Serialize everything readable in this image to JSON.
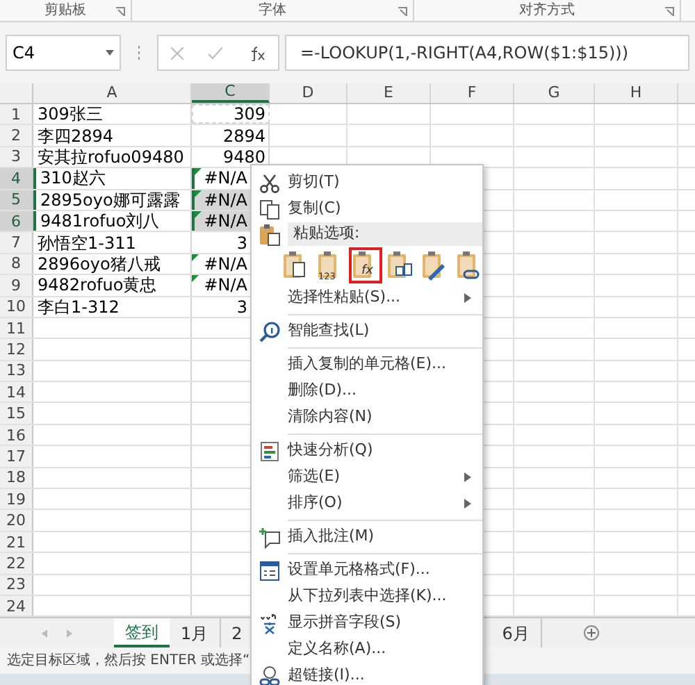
{
  "ribbon_groups": [
    {
      "label": "剪贴板"
    },
    {
      "label": "字体"
    },
    {
      "label": "对齐方式"
    }
  ],
  "formula_bar": {
    "name_box": "C4",
    "formula": "=-LOOKUP(1,-RIGHT(A4,ROW($1:$15)))"
  },
  "columns": [
    {
      "label": "A",
      "selected": false
    },
    {
      "label": "C",
      "selected": true
    },
    {
      "label": "D",
      "selected": false
    },
    {
      "label": "E",
      "selected": false
    },
    {
      "label": "F",
      "selected": false
    },
    {
      "label": "G",
      "selected": false
    },
    {
      "label": "H",
      "selected": false
    }
  ],
  "rows": [
    {
      "label": "1",
      "a": "309张三",
      "c": "309",
      "selected": false,
      "active": false,
      "flag": false,
      "copied": true
    },
    {
      "label": "2",
      "a": "李四2894",
      "c": "2894",
      "selected": false,
      "active": false,
      "flag": false,
      "copied": false
    },
    {
      "label": "3",
      "a": "安其拉rofuo09480",
      "c": "9480",
      "selected": false,
      "active": false,
      "flag": false,
      "copied": false
    },
    {
      "label": "4",
      "a": "310赵六",
      "c": "#N/A",
      "selected": true,
      "active": true,
      "flag": true,
      "copied": false
    },
    {
      "label": "5",
      "a": "2895oyo娜可露露",
      "c": "#N/A",
      "selected": true,
      "active": false,
      "flag": true,
      "copied": false
    },
    {
      "label": "6",
      "a": "9481rofuo刘八",
      "c": "#N/A",
      "selected": true,
      "active": false,
      "flag": true,
      "copied": false
    },
    {
      "label": "7",
      "a": "孙悟空1-311",
      "c": "3",
      "selected": false,
      "active": false,
      "flag": false,
      "copied": false
    },
    {
      "label": "8",
      "a": "2896oyo猪八戒",
      "c": "#N/A",
      "selected": false,
      "active": false,
      "flag": true,
      "copied": false
    },
    {
      "label": "9",
      "a": "9482rofuo黄忠",
      "c": "#N/A",
      "selected": false,
      "active": false,
      "flag": true,
      "copied": false
    },
    {
      "label": "10",
      "a": "李白1-312",
      "c": "3",
      "selected": false,
      "active": false,
      "flag": false,
      "copied": false
    },
    {
      "label": "11",
      "selected": false,
      "active": false,
      "flag": false,
      "copied": false
    },
    {
      "label": "12",
      "selected": false,
      "active": false,
      "flag": false,
      "copied": false
    },
    {
      "label": "13",
      "selected": false,
      "active": false,
      "flag": false,
      "copied": false
    },
    {
      "label": "14",
      "selected": false,
      "active": false,
      "flag": false,
      "copied": false
    },
    {
      "label": "15",
      "selected": false,
      "active": false,
      "flag": false,
      "copied": false
    },
    {
      "label": "16",
      "selected": false,
      "active": false,
      "flag": false,
      "copied": false
    },
    {
      "label": "17",
      "selected": false,
      "active": false,
      "flag": false,
      "copied": false
    },
    {
      "label": "18",
      "selected": false,
      "active": false,
      "flag": false,
      "copied": false
    },
    {
      "label": "19",
      "selected": false,
      "active": false,
      "flag": false,
      "copied": false
    },
    {
      "label": "20",
      "selected": false,
      "active": false,
      "flag": false,
      "copied": false
    },
    {
      "label": "21",
      "selected": false,
      "active": false,
      "flag": false,
      "copied": false
    },
    {
      "label": "22",
      "selected": false,
      "active": false,
      "flag": false,
      "copied": false
    },
    {
      "label": "23",
      "selected": false,
      "active": false,
      "flag": false,
      "copied": false
    },
    {
      "label": "24",
      "selected": false,
      "active": false,
      "flag": false,
      "copied": false
    }
  ],
  "sheet_tabs": [
    {
      "label": "签到",
      "selected": true
    },
    {
      "label": "1月",
      "selected": false
    },
    {
      "label": "2",
      "selected": false
    },
    {
      "label": "6月",
      "selected": false
    }
  ],
  "status_bar": "选定目标区域，然后按 ENTER 或选择“",
  "context_menu": [
    {
      "kind": "item",
      "label": "剪切(T)",
      "submenu": false
    },
    {
      "kind": "item",
      "label": "复制(C)",
      "submenu": false
    },
    {
      "kind": "header",
      "label": "粘贴选项:"
    },
    {
      "kind": "paste-icons",
      "options": [
        {
          "selected": false
        },
        {
          "selected": false,
          "glyph": "123"
        },
        {
          "selected": true,
          "glyph": "fx"
        },
        {
          "selected": false
        },
        {
          "selected": false
        },
        {
          "selected": false
        }
      ]
    },
    {
      "kind": "item",
      "label": "选择性粘贴(S)...",
      "submenu": true
    },
    {
      "kind": "separator"
    },
    {
      "kind": "item",
      "label": "智能查找(L)",
      "submenu": false
    },
    {
      "kind": "separator"
    },
    {
      "kind": "item",
      "label": "插入复制的单元格(E)...",
      "submenu": false
    },
    {
      "kind": "item",
      "label": "删除(D)...",
      "submenu": false
    },
    {
      "kind": "item",
      "label": "清除内容(N)",
      "submenu": false
    },
    {
      "kind": "separator"
    },
    {
      "kind": "item",
      "label": "快速分析(Q)",
      "submenu": false
    },
    {
      "kind": "item",
      "label": "筛选(E)",
      "submenu": true
    },
    {
      "kind": "item",
      "label": "排序(O)",
      "submenu": true
    },
    {
      "kind": "separator"
    },
    {
      "kind": "item",
      "label": "插入批注(M)",
      "submenu": false
    },
    {
      "kind": "separator"
    },
    {
      "kind": "item",
      "label": "设置单元格格式(F)...",
      "submenu": false
    },
    {
      "kind": "item",
      "label": "从下拉列表中选择(K)...",
      "submenu": false
    },
    {
      "kind": "item",
      "label": "显示拼音字段(S)",
      "submenu": false
    },
    {
      "kind": "item",
      "label": "定义名称(A)...",
      "submenu": false
    },
    {
      "kind": "item",
      "label": "超链接(I)...",
      "submenu": false
    }
  ]
}
